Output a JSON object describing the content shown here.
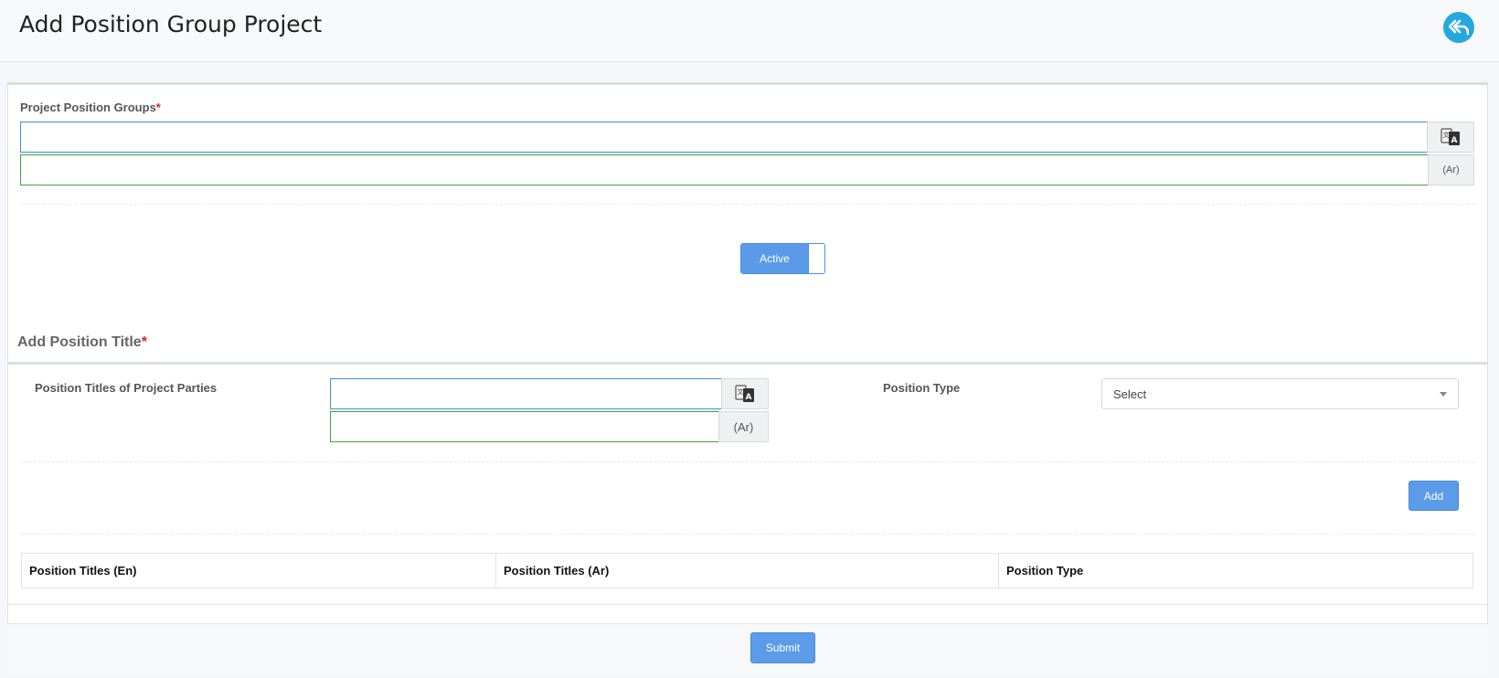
{
  "header": {
    "title": "Add Position Group Project",
    "back_icon": "reply-all-icon"
  },
  "group_form": {
    "label": "Project Position Groups",
    "required_mark": "*",
    "input_en_value": "",
    "input_ar_value": "",
    "translate_icon": "translate-icon",
    "ar_addon": "(Ar)"
  },
  "status_toggle": {
    "label": "Active",
    "state": "on"
  },
  "position_section": {
    "title": "Add Position Title",
    "required_mark": "*",
    "titles_label": "Position Titles of Project Parties",
    "title_en_value": "",
    "title_ar_value": "",
    "ar_addon": "(Ar)",
    "type_label": "Position Type",
    "type_selected": "Select",
    "add_button": "Add"
  },
  "table": {
    "columns": [
      "Position Titles (En)",
      "Position Titles (Ar)",
      "Position Type"
    ],
    "rows": []
  },
  "footer": {
    "submit_button": "Submit"
  },
  "colors": {
    "accent": "#5b9be8",
    "back_button": "#25a8df",
    "required": "#e02020",
    "valid_border": "#3aa542"
  }
}
